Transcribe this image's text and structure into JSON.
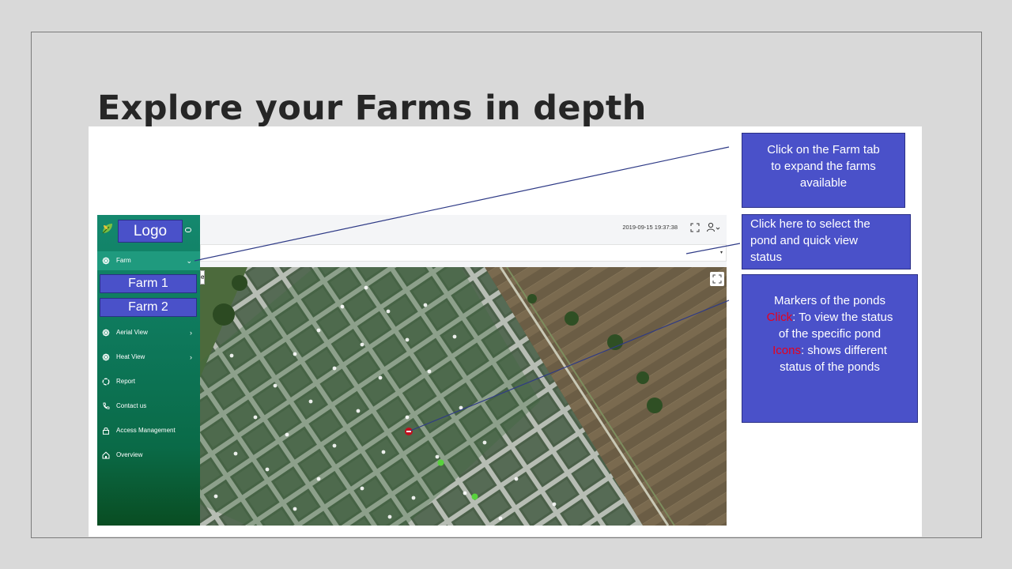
{
  "slide": {
    "title": "Explore your Farms in depth"
  },
  "app": {
    "logo_label": "Logo",
    "sidebar": {
      "items": [
        {
          "label": "Farm",
          "icon": "ship-wheel-icon",
          "chevron": "⌄"
        },
        {
          "label": "Aerial View",
          "icon": "ship-wheel-icon",
          "chevron": "›"
        },
        {
          "label": "Heat View",
          "icon": "ship-wheel-icon",
          "chevron": "›"
        },
        {
          "label": "Report",
          "icon": "report-icon"
        },
        {
          "label": "Contact us",
          "icon": "phone-icon"
        },
        {
          "label": "Access Management",
          "icon": "lock-icon"
        },
        {
          "label": "Overview",
          "icon": "home-icon"
        }
      ],
      "farms": [
        "Farm 1",
        "Farm 2"
      ]
    },
    "topbar": {
      "timestamp": "2019-09-15 19:37:38"
    },
    "select_caret": "▾",
    "map_edge_label": "e"
  },
  "callouts": {
    "farm_tab": [
      "Click on the Farm tab",
      "to expand the farms",
      "available"
    ],
    "pond_select": [
      "Click here to select the",
      "pond and quick view",
      "status"
    ],
    "markers": {
      "line1": "Markers of the ponds",
      "click_word": "Click",
      "click_rest": ": To view the status",
      "line3": "of the specific pond",
      "icons_word": "Icons",
      "icons_rest": ": shows different",
      "line5": "status of the ponds"
    }
  },
  "colors": {
    "callout_bg": "#4a51c9",
    "sidebar_top": "#14886e",
    "sidebar_bottom": "#094d22",
    "marker_alert": "#c0101e",
    "marker_ok": "#58d23c",
    "leader_line": "#2e3a86",
    "highlight_word": "#e8001c"
  }
}
